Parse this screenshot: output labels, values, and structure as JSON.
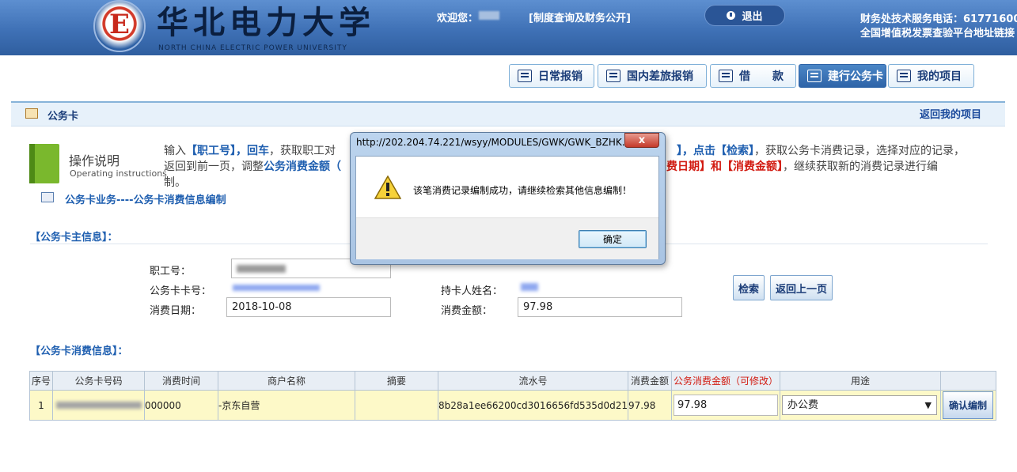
{
  "header": {
    "logo_letter": "E",
    "university_name": "华北电力大学",
    "university_name_en": "NORTH CHINA ELECTRIC POWER UNIVERSITY",
    "welcome_label": "欢迎您：",
    "disclosure_link": "[制度查询及财务公开]",
    "logout_label": "退出",
    "phone_text": "财务处技术服务电话：61771600",
    "verify_text": "全国增值税发票查验平台地址链接"
  },
  "nav": {
    "tabs": [
      {
        "label": "日常报销"
      },
      {
        "label": "国内差旅报销"
      },
      {
        "label": "借　　款"
      },
      {
        "label": "建行公务卡"
      },
      {
        "label": "我的项目"
      }
    ]
  },
  "titlebar": {
    "title": "公务卡",
    "back_link": "返回我的项目"
  },
  "instructions": {
    "title": "操作说明",
    "subtitle": "Operating instructions",
    "l1_a": "输入",
    "l1_b": "【职工号】，回车",
    "l1_c": "，获取职工对",
    "l1_r_a": "】，点击",
    "l1_r_b": "【检索】",
    "l1_r_c": "，获取公务卡消费记录，选择对应的记录，",
    "l2_a": "返回到前一页，调整",
    "l2_b": "公务消费金额（",
    "l2_r_a": "费日期】和【消费金额】",
    "l2_r_b": "，继续获取新的消费记录进行编",
    "l3": "制。"
  },
  "breadcrumb": "公务卡业务----公务卡消费信息编制",
  "main_info": {
    "section_title": "【公务卡主信息】：",
    "staff_no_label": "职工号：",
    "card_no_label": "公务卡卡号：",
    "holder_label": "持卡人姓名：",
    "date_label": "消费日期：",
    "date_value": "2018-10-08",
    "amount_label": "消费金额：",
    "amount_value": "97.98",
    "search_button": "检索",
    "back_button": "返回上一页"
  },
  "consumption": {
    "section_title": "【公务卡消费信息】：",
    "columns": [
      "序号",
      "公务卡号码",
      "消费时间",
      "商户名称",
      "摘要",
      "流水号",
      "消费金额",
      "公务消费金额（可修改）",
      "用途",
      ""
    ],
    "rows": [
      {
        "index": "1",
        "time": "000000",
        "merchant": "-京东自营",
        "summary": "",
        "serial": "8b28a1ee66200cd3016656fd535d0d21",
        "amount": "97.98",
        "official_amount": "97.98",
        "purpose": "办公费",
        "confirm_label": "确认编制"
      }
    ]
  },
  "dialog": {
    "title": "http://202.204.74.221/wsyy/MODULES/GWK/GWK_BZHK...",
    "close_label": "x",
    "message": "该笔消费记录编制成功，请继续检索其他信息编制！",
    "ok_label": "确定"
  }
}
